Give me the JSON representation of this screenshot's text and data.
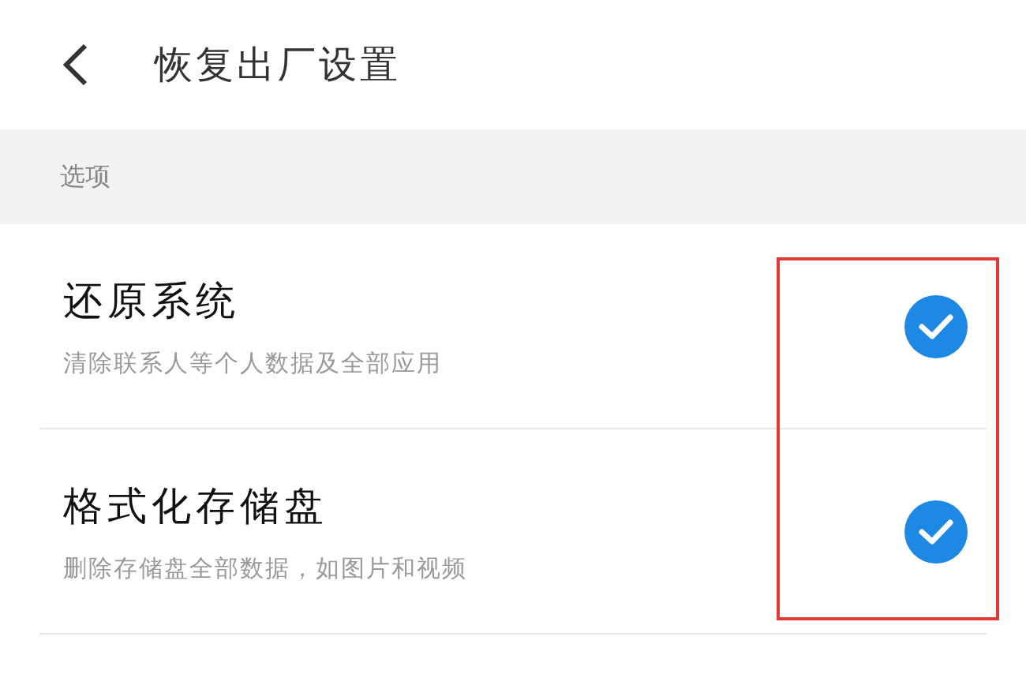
{
  "header": {
    "title": "恢复出厂设置"
  },
  "section": {
    "label": "选项"
  },
  "options": [
    {
      "title": "还原系统",
      "subtitle": "清除联系人等个人数据及全部应用",
      "checked": true
    },
    {
      "title": "格式化存储盘",
      "subtitle": "删除存储盘全部数据，如图片和视频",
      "checked": true
    }
  ]
}
